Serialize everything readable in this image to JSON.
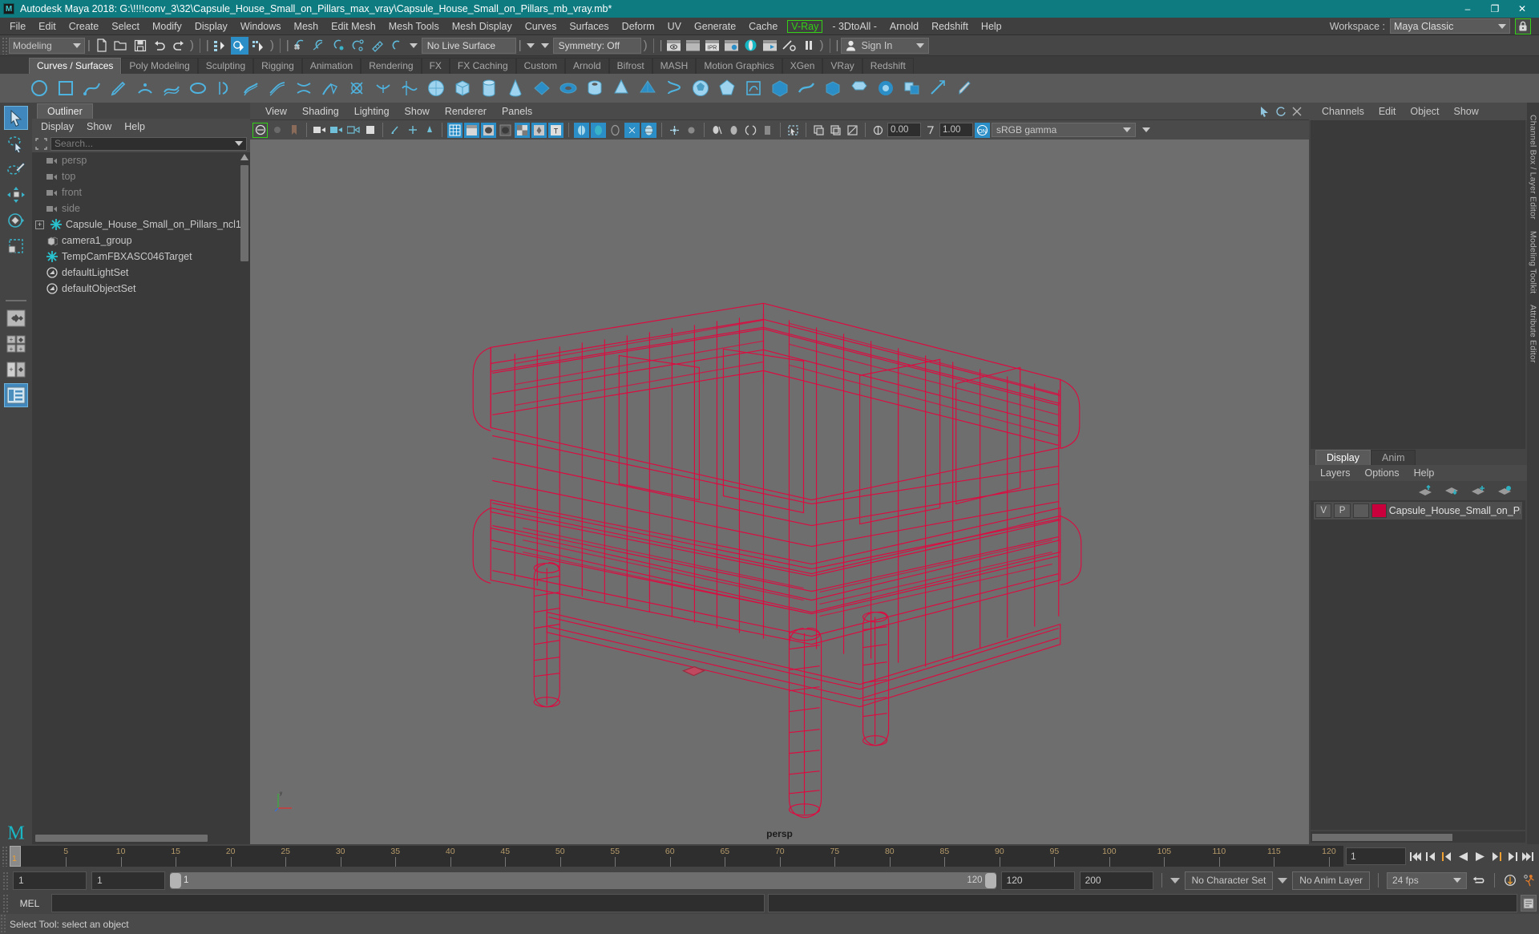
{
  "titlebar": {
    "app_icon": "maya-logo-icon",
    "title": "Autodesk Maya 2018: G:\\!!!!conv_3\\32\\Capsule_House_Small_on_Pillars_max_vray\\Capsule_House_Small_on_Pillars_mb_vray.mb*",
    "minimize": "–",
    "maximize": "❐",
    "close": "✕"
  },
  "menubar": {
    "items": [
      "File",
      "Edit",
      "Create",
      "Select",
      "Modify",
      "Display",
      "Windows",
      "Mesh",
      "Edit Mesh",
      "Mesh Tools",
      "Mesh Display",
      "Curves",
      "Surfaces",
      "Deform",
      "UV",
      "Generate",
      "Cache"
    ],
    "highlight_item": "V-Ray",
    "items_after": [
      "- 3DtoAll -",
      "Arnold",
      "Redshift",
      "Help"
    ],
    "workspace_label": "Workspace :",
    "workspace_value": "Maya Classic",
    "lock_icon": "lock-icon",
    "highlight_color": "#33d017"
  },
  "statusline": {
    "mode": "Modeling",
    "live_surface": "No Live Surface",
    "symmetry": "Symmetry: Off",
    "signin": "Sign In",
    "icons_file": [
      "new-scene-icon",
      "open-scene-icon",
      "save-scene-icon",
      "undo-icon",
      "redo-icon"
    ],
    "icons_select_mask": [
      "select-by-hierarchy-icon",
      "select-by-object-type-icon",
      "select-by-component-type-icon"
    ],
    "icons_snap": [
      "snap-to-grid-icon",
      "snap-to-curve-icon",
      "snap-to-point-icon",
      "snap-to-projected-center-icon",
      "snap-to-view-plane-icon",
      "make-live-icon"
    ],
    "icons_render": [
      "render-current-frame-icon",
      "ipr-render-icon",
      "render-settings-icon",
      "hypershade-icon",
      "render-view-icon",
      "render-setup-icon",
      "pause-render-icon"
    ]
  },
  "shelf": {
    "tabs": [
      "Curves / Surfaces",
      "Poly Modeling",
      "Sculpting",
      "Rigging",
      "Animation",
      "Rendering",
      "FX",
      "FX Caching",
      "Custom",
      "Arnold",
      "Bifrost",
      "MASH",
      "Motion Graphics",
      "XGen",
      "VRay",
      "Redshift"
    ],
    "active_tab": "Curves / Surfaces"
  },
  "toolbox": {
    "items": [
      {
        "name": "select-tool",
        "active": true
      },
      {
        "name": "lasso-select-tool",
        "active": false
      },
      {
        "name": "paint-select-tool",
        "active": false
      },
      {
        "name": "move-tool",
        "active": false
      },
      {
        "name": "rotate-tool",
        "active": false
      },
      {
        "name": "scale-tool",
        "active": false
      },
      {
        "name": "last-tool-used",
        "active": false
      },
      {
        "name": "single-perspective-view-layout",
        "active": false
      },
      {
        "name": "four-view-layout",
        "active": false
      },
      {
        "name": "persp-outliner-layout",
        "active": false
      },
      {
        "name": "hypergraph-layout",
        "active": true
      }
    ]
  },
  "outliner": {
    "tab_label": "Outliner",
    "menus": [
      "Display",
      "Show",
      "Help"
    ],
    "search_placeholder": "Search...",
    "filter_icon": "outliner-filter-icon",
    "rows": [
      {
        "label": "persp",
        "icon": "camera-icon",
        "dim": true,
        "expandable": false
      },
      {
        "label": "top",
        "icon": "camera-icon",
        "dim": true,
        "expandable": false
      },
      {
        "label": "front",
        "icon": "camera-icon",
        "dim": true,
        "expandable": false
      },
      {
        "label": "side",
        "icon": "camera-icon",
        "dim": true,
        "expandable": false
      },
      {
        "label": "Capsule_House_Small_on_Pillars_ncl1",
        "icon": "transform-node-icon",
        "dim": false,
        "expandable": true
      },
      {
        "label": "camera1_group",
        "icon": "group-node-icon",
        "dim": false,
        "expandable": false
      },
      {
        "label": "TempCamFBXASC046Target",
        "icon": "transform-node-icon",
        "dim": false,
        "expandable": false
      },
      {
        "label": "defaultLightSet",
        "icon": "set-node-icon",
        "dim": false,
        "expandable": false
      },
      {
        "label": "defaultObjectSet",
        "icon": "set-node-icon",
        "dim": false,
        "expandable": false
      }
    ]
  },
  "viewport": {
    "menus": [
      "View",
      "Shading",
      "Lighting",
      "Show",
      "Renderer",
      "Panels"
    ],
    "exposure_value": "0.00",
    "gamma_value": "1.00",
    "color_space": "sRGB gamma",
    "camera_label": "persp",
    "background_color": "#6e6e6e",
    "wireframe_color": "#e0083f",
    "axis_icon": "axis-gizmo-icon"
  },
  "channelbox": {
    "menus": [
      "Channels",
      "Edit",
      "Object",
      "Show"
    ],
    "vertical_tabs": [
      "Channel Box / Layer Editor",
      "Modeling Toolkit",
      "Attribute Editor"
    ]
  },
  "layers": {
    "tabs": [
      "Display",
      "Anim"
    ],
    "active_tab": "Display",
    "menus": [
      "Layers",
      "Options",
      "Help"
    ],
    "buttons": [
      "move-layer-up-icon",
      "move-layer-down-icon",
      "create-new-layer-icon",
      "create-layer-from-selected-icon"
    ],
    "rows": [
      {
        "v": "V",
        "p": "P",
        "third": "",
        "color": "#c9003c",
        "name": "Capsule_House_Small_on_Pilla"
      }
    ]
  },
  "timeline": {
    "current_frame": "1",
    "ticks": [
      "5",
      "10",
      "15",
      "20",
      "25",
      "30",
      "35",
      "40",
      "45",
      "50",
      "55",
      "60",
      "65",
      "70",
      "75",
      "80",
      "85",
      "90",
      "95",
      "100",
      "105",
      "110",
      "115",
      "120"
    ],
    "frame_field": "1",
    "playback_buttons": [
      "go-to-start-icon",
      "step-back-frame-icon",
      "step-back-key-icon",
      "play-backwards-icon",
      "play-forwards-icon",
      "step-forward-key-icon",
      "step-forward-frame-icon",
      "go-to-end-icon"
    ]
  },
  "range": {
    "anim_start": "1",
    "range_start": "1",
    "slider_min": "1",
    "slider_max": "120",
    "range_end": "120",
    "anim_end": "200",
    "character_set": "No Character Set",
    "anim_layer": "No Anim Layer",
    "fps": "24 fps",
    "auto_key_icon": "auto-keyframe-icon",
    "anim_prefs_icon": "animation-preferences-icon",
    "loop_icon": "playback-loop-icon"
  },
  "command": {
    "language": "MEL",
    "input_value": "",
    "script_editor_icon": "script-editor-icon"
  },
  "helpline": {
    "text": "Select Tool: select an object"
  }
}
